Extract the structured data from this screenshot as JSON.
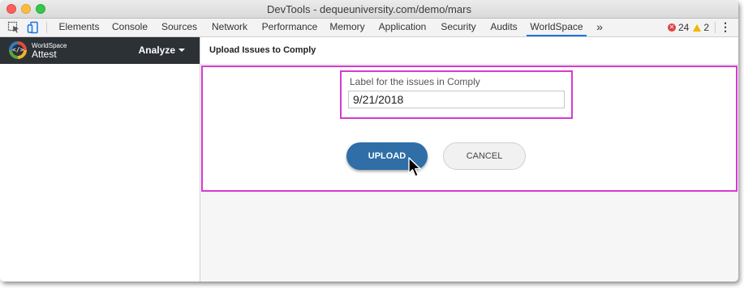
{
  "window": {
    "title": "DevTools - dequeuniversity.com/demo/mars"
  },
  "toolbar": {
    "tabs": [
      {
        "label": "Elements"
      },
      {
        "label": "Console"
      },
      {
        "label": "Sources"
      },
      {
        "label": "Network"
      },
      {
        "label": "Performance"
      },
      {
        "label": "Memory"
      },
      {
        "label": "Application"
      },
      {
        "label": "Security"
      },
      {
        "label": "Audits"
      },
      {
        "label": "WorldSpace"
      }
    ],
    "active_tab": "WorldSpace",
    "more_label": "»",
    "error_count": "24",
    "warning_count": "2",
    "menu_glyph": "⋮"
  },
  "sidebar": {
    "brand_top": "WorldSpace",
    "brand_name": "Attest",
    "analyze_label": "Analyze"
  },
  "main": {
    "title": "Upload Issues to Comply",
    "field_label": "Label for the issues in Comply",
    "field_value": "9/21/2018",
    "upload_label": "UPLOAD",
    "cancel_label": "CANCEL"
  },
  "colors": {
    "accent_tab": "#1a73e8",
    "sidebar_header": "#2c3136",
    "upload_button": "#2f6ea7",
    "highlight_border": "#d63ad3"
  }
}
